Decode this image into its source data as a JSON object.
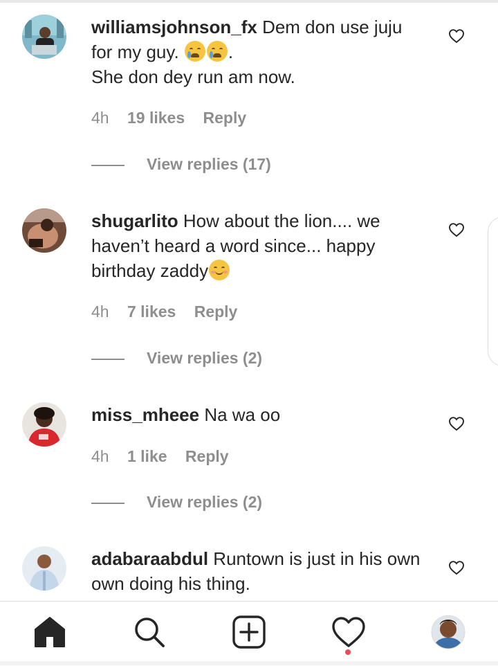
{
  "comments": [
    {
      "username": "williamsjohnson_fx",
      "text_before": "Dem don use juju for my guy.",
      "emojis": [
        "crying-face-emoji",
        "crying-face-emoji"
      ],
      "text_after": ".",
      "text_line2": "She don dey run am now.",
      "time": "4h",
      "likes": "19 likes",
      "reply": "Reply",
      "view_replies": "View replies (17)"
    },
    {
      "username": "shugarlito",
      "text_before": "How about the lion.... we haven’t heard a word since... happy birthday zaddy",
      "emojis": [
        "smiling-face-emoji"
      ],
      "time": "4h",
      "likes": "7 likes",
      "reply": "Reply",
      "view_replies": "View replies (2)"
    },
    {
      "username": "miss_mheee",
      "text_before": "Na wa oo",
      "time": "4h",
      "likes": "1 like",
      "reply": "Reply",
      "view_replies": "View replies (2)"
    },
    {
      "username": "adabaraabdul",
      "text_before": "Runtown is just in his own own doing his thing."
    }
  ],
  "nav": {
    "items": [
      "home-icon",
      "search-icon",
      "new-post-icon",
      "activity-heart-icon",
      "profile-avatar"
    ],
    "active": "home-icon",
    "notification_color": "#ed4956"
  },
  "colors": {
    "text": "#262626",
    "secondary": "#8e8e8e"
  }
}
